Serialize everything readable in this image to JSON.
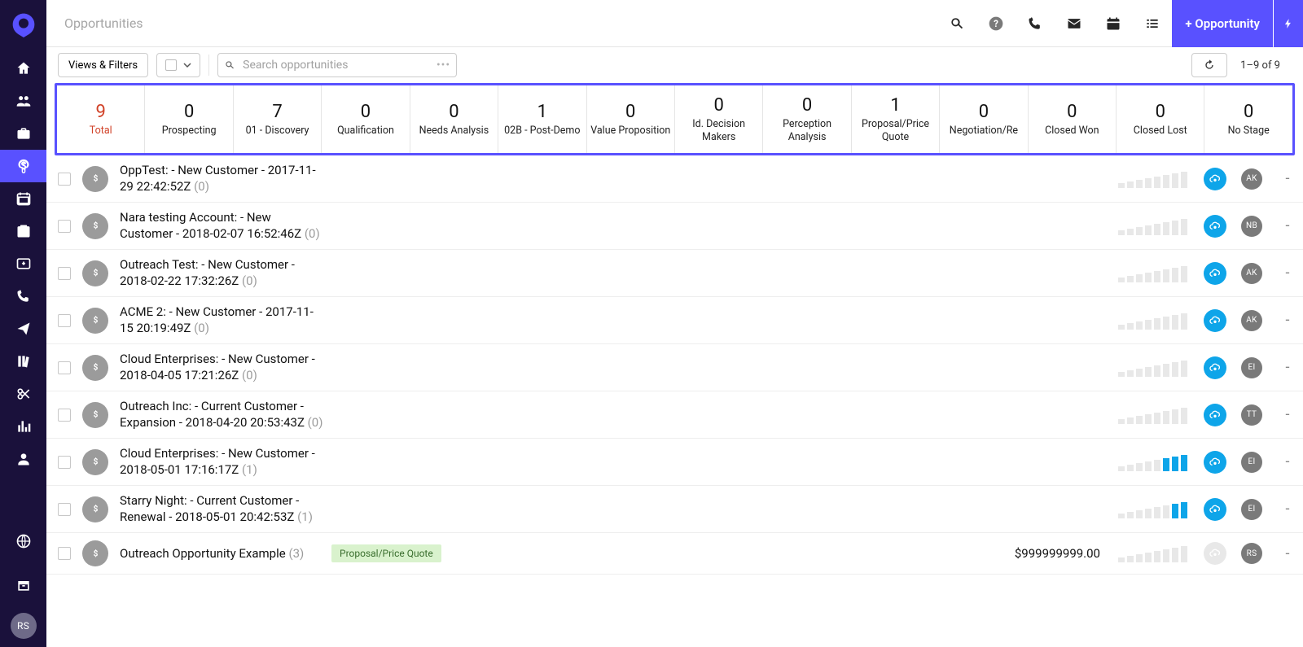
{
  "header": {
    "title": "Opportunities",
    "new_button": "+ Opportunity"
  },
  "toolbar": {
    "views_filters": "Views & Filters",
    "search_placeholder": "Search opportunities",
    "page_info": "1–9 of 9"
  },
  "sidebar_avatar": "RS",
  "stages": [
    {
      "count": "9",
      "label": "Total",
      "total": true
    },
    {
      "count": "0",
      "label": "Prospecting"
    },
    {
      "count": "7",
      "label": "01 - Discovery"
    },
    {
      "count": "0",
      "label": "Qualification"
    },
    {
      "count": "0",
      "label": "Needs Analysis"
    },
    {
      "count": "1",
      "label": "02B - Post-Demo"
    },
    {
      "count": "0",
      "label": "Value Proposition"
    },
    {
      "count": "0",
      "label": "Id. Decision Makers"
    },
    {
      "count": "0",
      "label": "Perception Analysis"
    },
    {
      "count": "1",
      "label": "Proposal/Price Quote"
    },
    {
      "count": "0",
      "label": "Negotiation/Re"
    },
    {
      "count": "0",
      "label": "Closed Won"
    },
    {
      "count": "0",
      "label": "Closed Lost"
    },
    {
      "count": "0",
      "label": "No Stage"
    }
  ],
  "rows": [
    {
      "title": "OppTest: - New Customer - 2017-11-29 22:42:52Z",
      "paren": "(0)",
      "bars": [
        0,
        0,
        0,
        0,
        0,
        0,
        0,
        0
      ],
      "cloud": true,
      "owner": "AK"
    },
    {
      "title": "Nara testing Account: - New Customer - 2018-02-07 16:52:46Z",
      "paren": "(0)",
      "bars": [
        0,
        0,
        0,
        0,
        0,
        0,
        0,
        0
      ],
      "cloud": true,
      "owner": "NB"
    },
    {
      "title": "Outreach Test: - New Customer - 2018-02-22 17:32:26Z",
      "paren": "(0)",
      "bars": [
        0,
        0,
        0,
        0,
        0,
        0,
        0,
        0
      ],
      "cloud": true,
      "owner": "AK"
    },
    {
      "title": "ACME 2: - New Customer - 2017-11-15 20:19:49Z",
      "paren": "(0)",
      "bars": [
        0,
        0,
        0,
        0,
        0,
        0,
        0,
        0
      ],
      "cloud": true,
      "owner": "AK"
    },
    {
      "title": "Cloud Enterprises: - New Customer - 2018-04-05 17:21:26Z",
      "paren": "(0)",
      "bars": [
        0,
        0,
        0,
        0,
        0,
        0,
        0,
        0
      ],
      "cloud": true,
      "owner": "EI"
    },
    {
      "title": "Outreach Inc: - Current Customer - Expansion - 2018-04-20 20:53:43Z",
      "paren": "(0)",
      "bars": [
        0,
        0,
        0,
        0,
        0,
        0,
        0,
        0
      ],
      "cloud": true,
      "owner": "TT"
    },
    {
      "title": "Cloud Enterprises: - New Customer - 2018-05-01 17:16:17Z",
      "paren": "(1)",
      "bars": [
        0,
        0,
        0,
        0,
        0,
        1,
        1,
        1
      ],
      "cloud": true,
      "owner": "EI"
    },
    {
      "title": "Starry Night: - Current Customer - Renewal - 2018-05-01 20:42:53Z",
      "paren": "(1)",
      "bars": [
        0,
        0,
        0,
        0,
        0,
        0,
        1,
        1
      ],
      "cloud": true,
      "owner": "EI"
    },
    {
      "title": "Outreach Opportunity Example",
      "paren": "(3)",
      "pill": "Proposal/Price Quote",
      "amount": "$999999999.00",
      "bars": [
        0,
        0,
        0,
        0,
        0,
        0,
        0,
        0
      ],
      "cloud": false,
      "owner": "RS"
    }
  ]
}
